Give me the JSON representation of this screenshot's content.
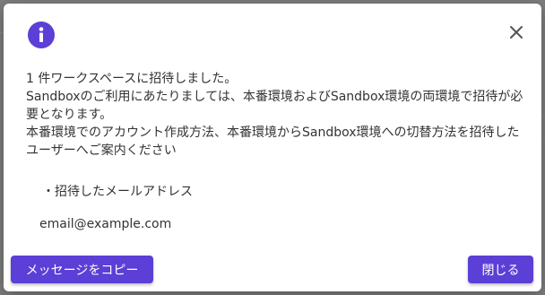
{
  "dialog": {
    "icon": "info-icon",
    "close_icon": "close-icon",
    "lines": [
      "1 件ワークスペースに招待しました。",
      "Sandboxのご利用にあたりましては、本番環境およびSandbox環境の両環境で招待が必",
      "要となります。",
      "本番環境でのアカウント作成方法、本番環境からSandbox環境への切替方法を招待した",
      "ユーザーへご案内ください"
    ],
    "bullet_label": "・招待したメールアドレス",
    "email": "email@example.com",
    "copy_button_label": "メッセージをコピー",
    "close_button_label": "閉じる"
  },
  "colors": {
    "accent": "#5b3fd6",
    "overlay": "#7f7f7f",
    "text": "#333333"
  }
}
